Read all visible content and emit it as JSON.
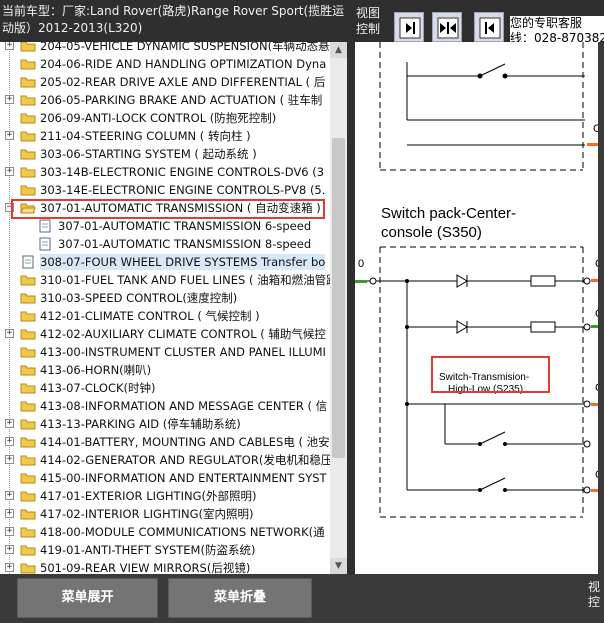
{
  "header": {
    "vehicle_line1": "当前车型：厂家:Land Rover(路虎)Range Rover Sport(揽胜运",
    "vehicle_line2": "动版）2012-2013(L320)",
    "view_label_1": "视图",
    "view_label_2": "控制",
    "service_line1": "您的专职客服",
    "service_line2": "线：028-870382"
  },
  "tree": {
    "items": [
      {
        "label": "204-05-VEHICLE DYNAMIC SUSPENSION(车辆动态悬",
        "expander": true,
        "icon": "folder"
      },
      {
        "label": "204-06-RIDE AND HANDLING OPTIMIZATION Dyna",
        "expander": false,
        "icon": "folder"
      },
      {
        "label": "205-02-REAR DRIVE AXLE AND DIFFERENTIAL ( 后",
        "expander": false,
        "icon": "folder"
      },
      {
        "label": "206-05-PARKING BRAKE AND ACTUATION ( 驻车制",
        "expander": true,
        "icon": "folder"
      },
      {
        "label": "206-09-ANTI-LOCK CONTROL (防抱死控制)",
        "expander": false,
        "icon": "folder"
      },
      {
        "label": "211-04-STEERING COLUMN ( 转向柱 )",
        "expander": true,
        "icon": "folder"
      },
      {
        "label": "303-06-STARTING SYSTEM ( 起动系统 )",
        "expander": false,
        "icon": "folder"
      },
      {
        "label": "303-14B-ELECTRONIC ENGINE CONTROLS-DV6 (3",
        "expander": true,
        "icon": "folder"
      },
      {
        "label": "303-14E-ELECTRONIC ENGINE CONTROLS-PV8 (5.",
        "expander": false,
        "icon": "folder"
      },
      {
        "label": "307-01-AUTOMATIC TRANSMISSION ( 自动变速箱 )",
        "expander": true,
        "expanded": true,
        "icon": "folder-open"
      },
      {
        "label": "307-01-AUTOMATIC TRANSMISSION 6-speed",
        "child": true,
        "icon": "doc"
      },
      {
        "label": "307-01-AUTOMATIC TRANSMISSION 8-speed",
        "child": true,
        "icon": "doc"
      },
      {
        "label": "308-07-FOUR WHEEL DRIVE SYSTEMS Transfer bo",
        "expander": false,
        "icon": "doc",
        "selected": true
      },
      {
        "label": "310-01-FUEL TANK AND FUEL LINES ( 油箱和燃油管路",
        "expander": false,
        "icon": "folder"
      },
      {
        "label": "310-03-SPEED CONTROL(速度控制)",
        "expander": false,
        "icon": "folder"
      },
      {
        "label": "412-01-CLIMATE CONTROL ( 气候控制 )",
        "expander": false,
        "icon": "folder"
      },
      {
        "label": "412-02-AUXILIARY CLIMATE CONTROL ( 辅助气候控",
        "expander": true,
        "icon": "folder"
      },
      {
        "label": "413-00-INSTRUMENT CLUSTER AND PANEL ILLUMI",
        "expander": false,
        "icon": "folder"
      },
      {
        "label": "413-06-HORN(喇叭)",
        "expander": false,
        "icon": "folder"
      },
      {
        "label": "413-07-CLOCK(时钟)",
        "expander": false,
        "icon": "folder"
      },
      {
        "label": "413-08-INFORMATION AND MESSAGE CENTER ( 信",
        "expander": false,
        "icon": "folder"
      },
      {
        "label": "413-13-PARKING AID (停车辅助系统)",
        "expander": true,
        "icon": "folder"
      },
      {
        "label": "414-01-BATTERY, MOUNTING AND CABLES电 ( 池安",
        "expander": true,
        "icon": "folder"
      },
      {
        "label": "414-02-GENERATOR AND REGULATOR(发电机和稳压",
        "expander": true,
        "icon": "folder"
      },
      {
        "label": "415-00-INFORMATION AND ENTERTAINMENT SYST",
        "expander": false,
        "icon": "folder"
      },
      {
        "label": "417-01-EXTERIOR LIGHTING(外部照明)",
        "expander": true,
        "icon": "folder"
      },
      {
        "label": "417-02-INTERIOR LIGHTING(室内照明)",
        "expander": true,
        "icon": "folder"
      },
      {
        "label": "418-00-MODULE COMMUNICATIONS NETWORK(通",
        "expander": true,
        "icon": "folder"
      },
      {
        "label": "419-01-ANTI-THEFT SYSTEM(防盗系统)",
        "expander": true,
        "icon": "folder"
      },
      {
        "label": "501-09-REAR VIEW MIRRORS(后视镜)",
        "expander": true,
        "icon": "folder"
      }
    ]
  },
  "diagram": {
    "heading_line1": "Switch pack-Center-",
    "heading_line2": "console (S350)",
    "left_pin": "0",
    "right_label_top": "C0",
    "right_labels": [
      "C",
      "C",
      "C",
      "C"
    ],
    "switch_label_line1": "Switch-Transmision-",
    "switch_label_line2": "High-Low (S235)"
  },
  "buttons": {
    "expand_menu": "菜单展开",
    "collapse_menu": "菜单折叠"
  },
  "footer": {
    "view_label_1": "视",
    "view_label_2": "控"
  },
  "colors": {
    "highlight": "#e53935",
    "folder": "#f2c84b",
    "wire_orange": "#e8722a",
    "wire_green": "#3a9a2e"
  }
}
